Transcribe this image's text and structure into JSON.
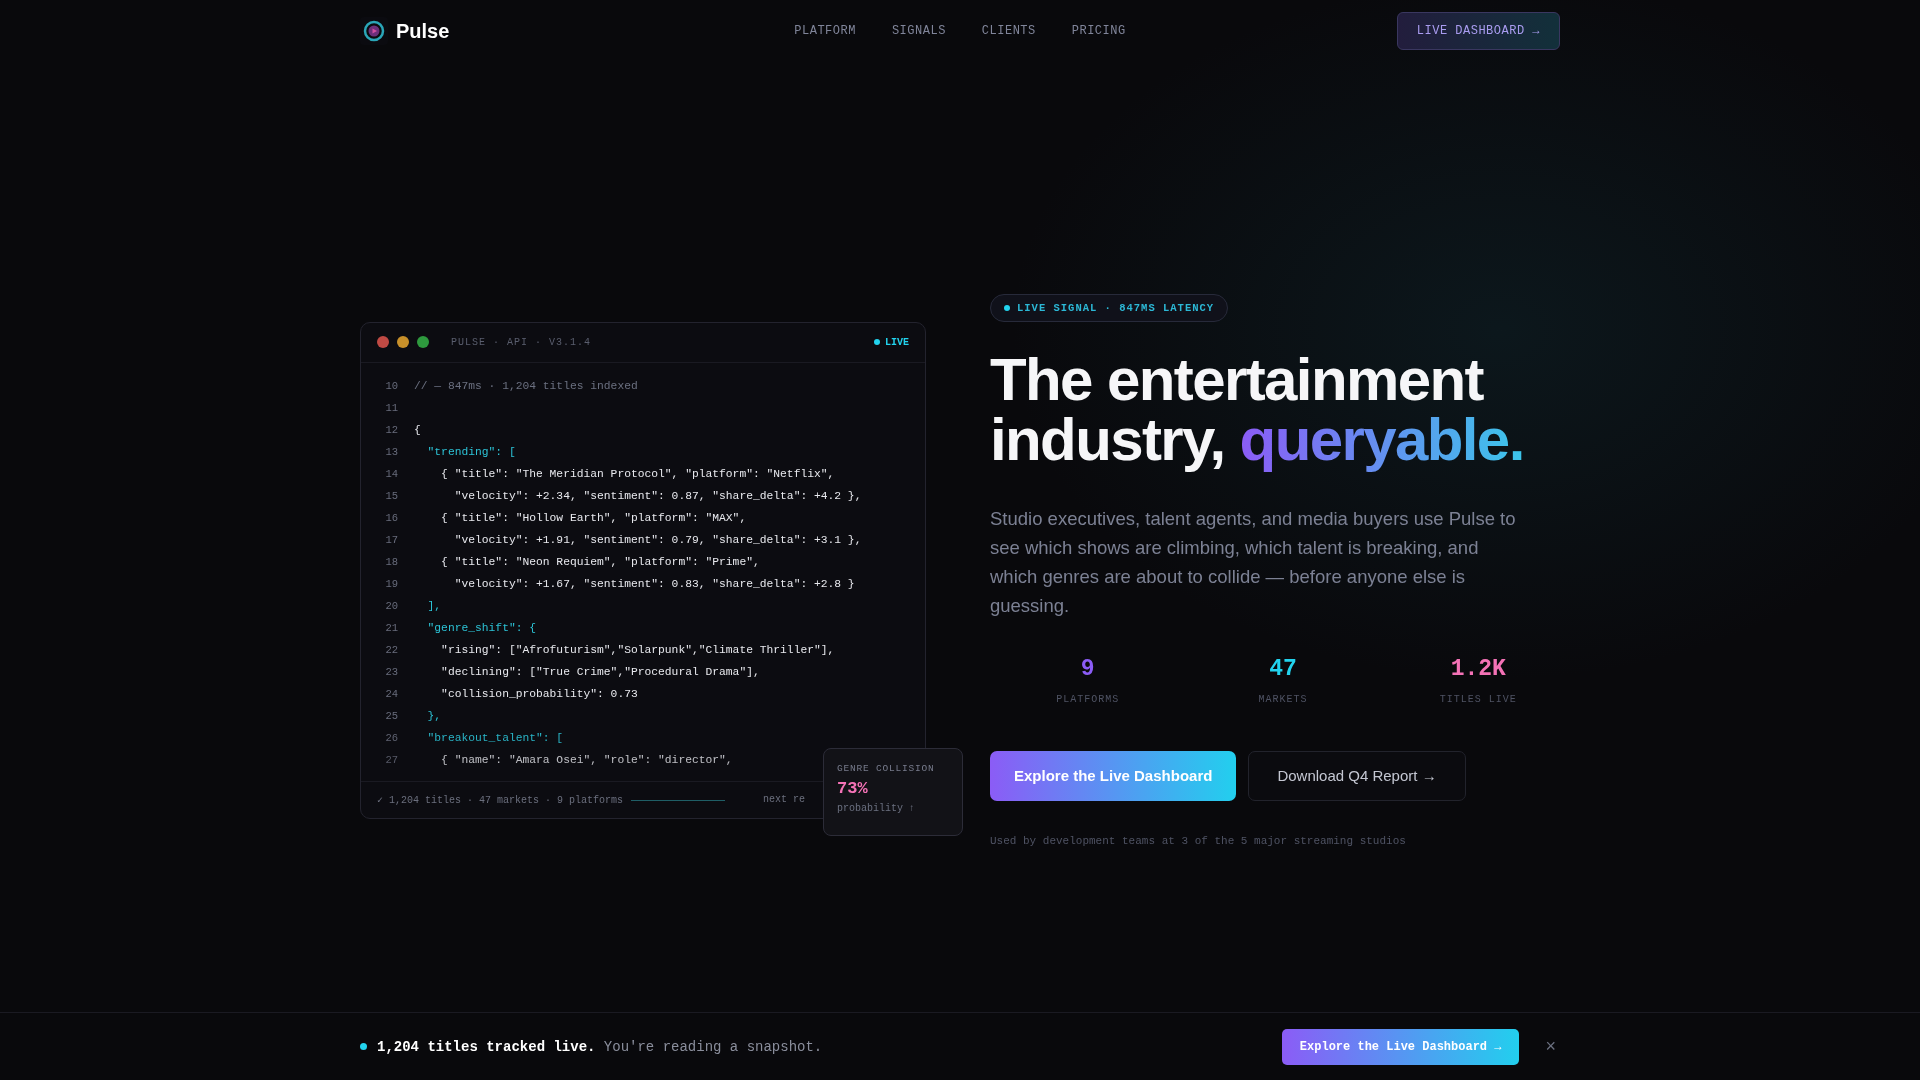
{
  "nav": {
    "brand": "Pulse",
    "links": [
      "PLATFORM",
      "SIGNALS",
      "CLIENTS",
      "PRICING"
    ],
    "cta": "LIVE DASHBOARD →"
  },
  "code_panel": {
    "title": "PULSE · API · V3.1.4",
    "status": "LIVE",
    "lines": [
      {
        "number": "10",
        "kind": "comment",
        "text": "// — 847ms · 1,204 titles indexed"
      },
      {
        "number": "11"
      },
      {
        "number": "12",
        "kind": "plain",
        "text": "{"
      },
      {
        "number": "13",
        "kind": "key",
        "text": "  \"trending\": ["
      },
      {
        "number": "14",
        "kind": "plain",
        "text": "    { \"title\": \"The Meridian Protocol\", \"platform\": \"Netflix\","
      },
      {
        "number": "15",
        "kind": "plain",
        "text": "      \"velocity\": +2.34, \"sentiment\": 0.87, \"share_delta\": +4.2 },"
      },
      {
        "number": "16",
        "kind": "plain",
        "text": "    { \"title\": \"Hollow Earth\", \"platform\": \"MAX\","
      },
      {
        "number": "17",
        "kind": "plain",
        "text": "      \"velocity\": +1.91, \"sentiment\": 0.79, \"share_delta\": +3.1 },"
      },
      {
        "number": "18",
        "kind": "plain",
        "text": "    { \"title\": \"Neon Requiem\", \"platform\": \"Prime\","
      },
      {
        "number": "19",
        "kind": "plain",
        "text": "      \"velocity\": +1.67, \"sentiment\": 0.83, \"share_delta\": +2.8 }"
      },
      {
        "number": "20",
        "kind": "key",
        "text": "  ],"
      },
      {
        "number": "21",
        "kind": "key",
        "text": "  \"genre_shift\": {"
      },
      {
        "number": "22",
        "kind": "plain",
        "text": "    \"rising\": [\"Afrofuturism\",\"Solarpunk\",\"Climate Thriller\"],"
      },
      {
        "number": "23",
        "kind": "plain",
        "text": "    \"declining\": [\"True Crime\",\"Procedural Drama\"],"
      },
      {
        "number": "24",
        "kind": "plain",
        "text": "    \"collision_probability\": 0.73"
      },
      {
        "number": "25",
        "kind": "key",
        "text": "  },"
      },
      {
        "number": "26",
        "kind": "key",
        "text": "  \"breakout_talent\": ["
      },
      {
        "number": "27",
        "kind": "plain",
        "text": "    { \"name\": \"Amara Osei\", \"role\": \"director\","
      }
    ],
    "footer": "✓ 1,204 titles · 47 markets · 9 platforms",
    "footer_right": "next re",
    "overlay": {
      "label": "GENRE COLLISION",
      "value": "73%",
      "caption": "probability ↑"
    }
  },
  "hero": {
    "badge": "LIVE SIGNAL · 847MS LATENCY",
    "headline_line1": "The entertainment",
    "headline_line2": "industry,",
    "headline_accent": "queryable.",
    "description": "Studio executives, talent agents, and media buyers use Pulse to see which shows are climbing, which talent is breaking, and which genres are about to collide — before anyone else is guessing.",
    "stats": [
      {
        "value": "9",
        "label": "PLATFORMS",
        "color": "#8b5cf6"
      },
      {
        "value": "47",
        "label": "MARKETS",
        "color": "#22d3ee"
      },
      {
        "value": "1.2K",
        "label": "TITLES LIVE",
        "color": "#f472b6"
      }
    ],
    "primary_button": "Explore the Live Dashboard",
    "secondary_button": "Download Q4 Report →",
    "caption": "Used by development teams at 3 of the 5 major streaming studios"
  },
  "bottom_bar": {
    "text": "**1,204 titles tracked live.** You're reading a snapshot.",
    "button": "Explore the Live Dashboard →",
    "close": "×"
  }
}
